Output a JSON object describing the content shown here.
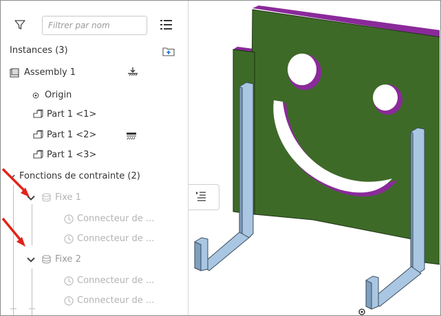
{
  "toolbar": {
    "filter_placeholder": "Filtrer par nom"
  },
  "instances": {
    "header": "Instances (3)",
    "items": [
      {
        "label": "Assembly 1"
      },
      {
        "label": "Origin"
      },
      {
        "label": "Part 1 <1>"
      },
      {
        "label": "Part 1 <2>"
      },
      {
        "label": "Part 1 <3>"
      }
    ]
  },
  "constraints": {
    "header": "Fonctions de contrainte (2)",
    "groups": [
      {
        "label": "Fixe 1",
        "children": [
          "Connecteur de ...",
          "Connecteur de ..."
        ]
      },
      {
        "label": "Fixe 2",
        "children": [
          "Connecteur de ...",
          "Connecteur de ..."
        ]
      }
    ]
  },
  "colors": {
    "panel_green": "#3e6a28",
    "edge_purple": "#8a2a9a",
    "bracket_blue": "#a9c6e2",
    "arrow_red": "#e2231a"
  }
}
